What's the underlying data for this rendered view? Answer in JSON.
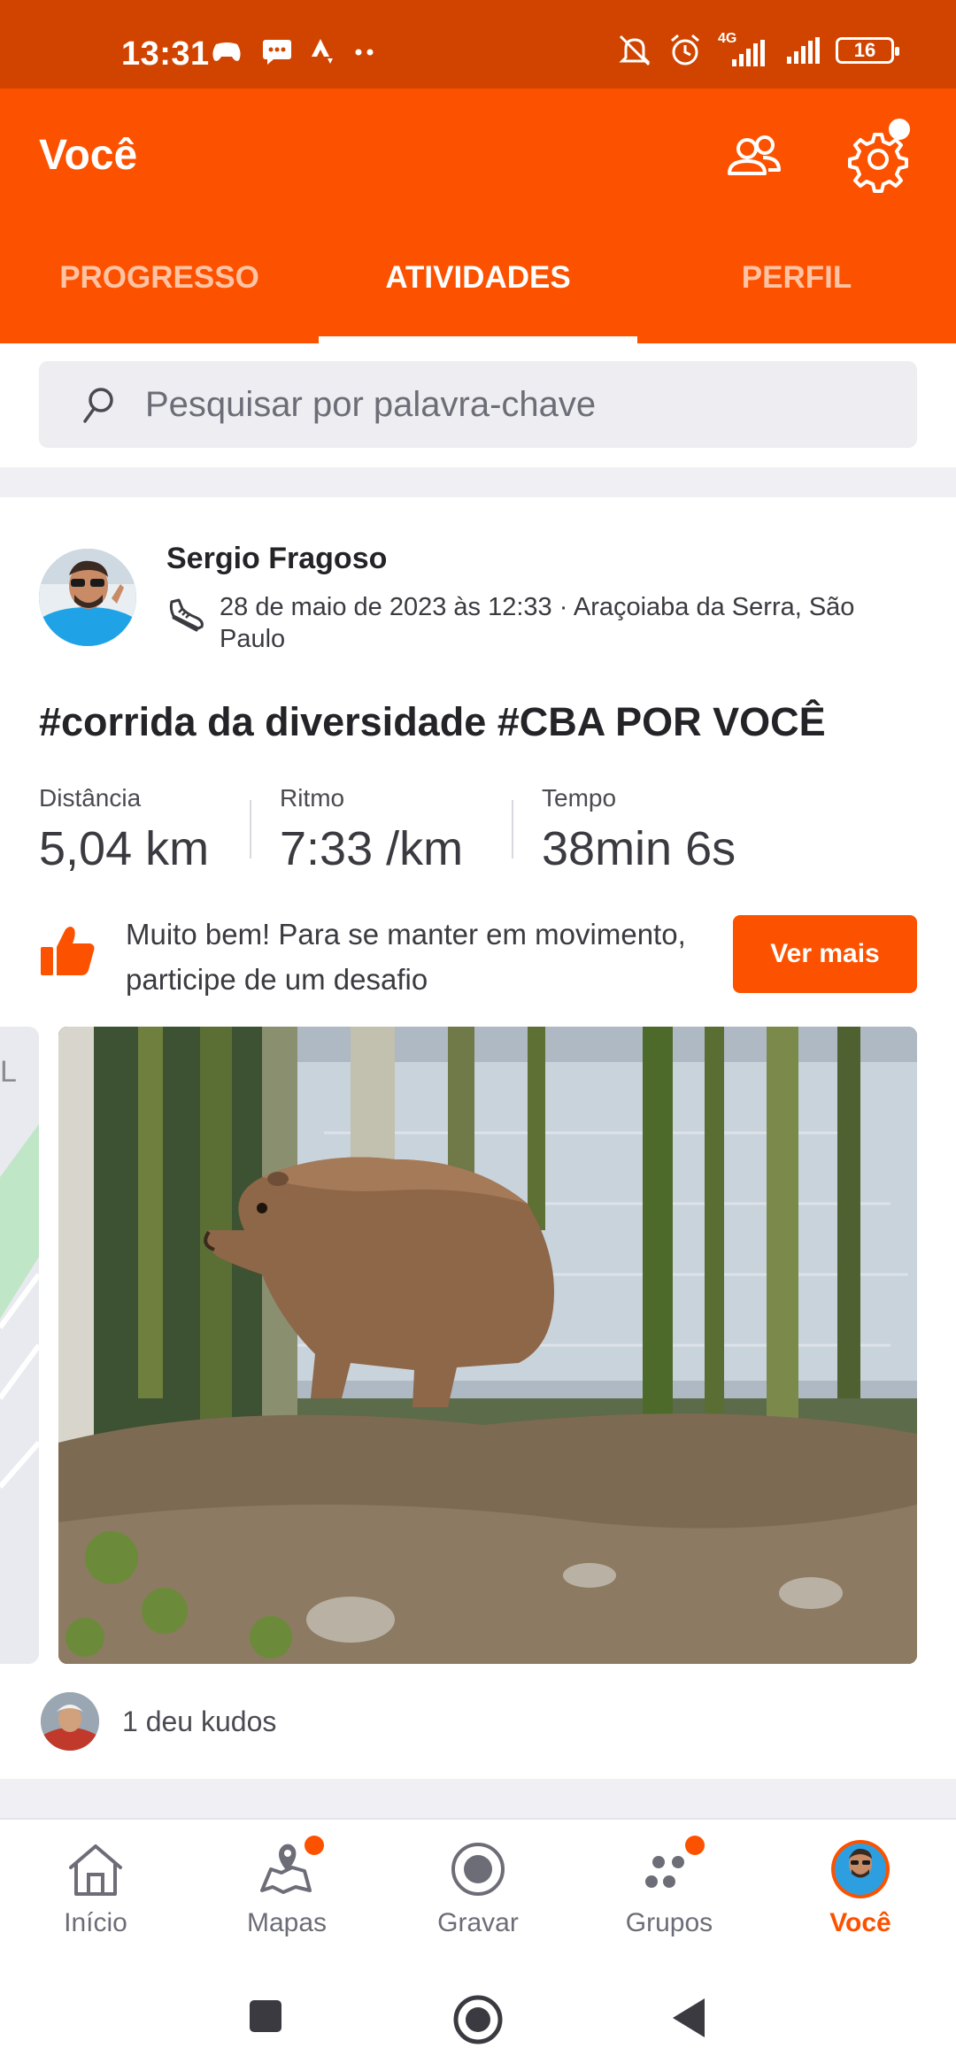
{
  "status_bar": {
    "time": "13:31",
    "network": "4G",
    "battery": "16"
  },
  "header": {
    "title": "Você",
    "tabs": [
      {
        "label": "PROGRESSO",
        "active": false
      },
      {
        "label": "ATIVIDADES",
        "active": true
      },
      {
        "label": "PERFIL",
        "active": false
      }
    ]
  },
  "search": {
    "placeholder": "Pesquisar por palavra-chave"
  },
  "activity": {
    "athlete": "Sergio Fragoso",
    "meta": "28 de maio de 2023 às 12:33 · Araçoiaba da Serra, São Paulo",
    "title": "#corrida da diversidade #CBA POR VOCÊ",
    "stats": [
      {
        "label": "Distância",
        "value": "5,04 km"
      },
      {
        "label": "Ritmo",
        "value": "7:33 /km"
      },
      {
        "label": "Tempo",
        "value": "38min 6s"
      }
    ],
    "prompt": "Muito bem! Para se manter em movimento, participe de um desafio",
    "prompt_button": "Ver mais",
    "kudos": "1 deu kudos"
  },
  "bottom_nav": [
    {
      "label": "Início",
      "icon": "home-icon",
      "active": false,
      "badge": false
    },
    {
      "label": "Mapas",
      "icon": "map-icon",
      "active": false,
      "badge": true
    },
    {
      "label": "Gravar",
      "icon": "record-icon",
      "active": false,
      "badge": false
    },
    {
      "label": "Grupos",
      "icon": "groups-icon",
      "active": false,
      "badge": true
    },
    {
      "label": "Você",
      "icon": "profile-avatar",
      "active": true,
      "badge": false
    }
  ],
  "colors": {
    "brand": "#fc5200",
    "status_bar": "#d14400",
    "tab_inactive": "#ffc3a4"
  }
}
